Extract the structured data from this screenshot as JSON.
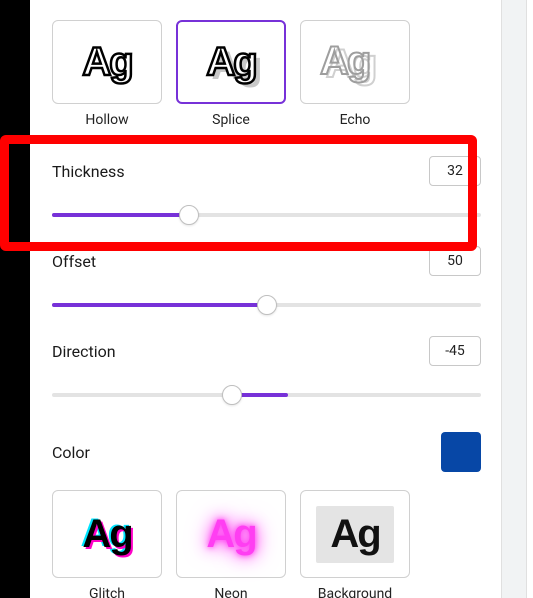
{
  "styles": {
    "top": [
      {
        "id": "hollow",
        "label": "Hollow",
        "selected": false
      },
      {
        "id": "splice",
        "label": "Splice",
        "selected": true
      },
      {
        "id": "echo",
        "label": "Echo",
        "selected": false
      }
    ],
    "bottom": [
      {
        "id": "glitch",
        "label": "Glitch"
      },
      {
        "id": "neon",
        "label": "Neon"
      },
      {
        "id": "background",
        "label": "Background"
      }
    ]
  },
  "controls": {
    "thickness": {
      "label": "Thickness",
      "value": "32",
      "percent": 32
    },
    "offset": {
      "label": "Offset",
      "value": "50",
      "percent": 50
    },
    "direction": {
      "label": "Direction",
      "value": "-45",
      "center_percent": 42,
      "fill_start": 42,
      "fill_end": 55
    }
  },
  "color": {
    "label": "Color",
    "value": "#0747a6"
  },
  "highlight_target": "thickness"
}
